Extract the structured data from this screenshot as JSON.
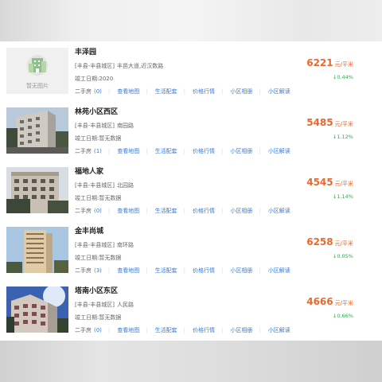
{
  "labels": {
    "no_image": "暂无图片",
    "year_prefix": "竣工日期:",
    "second_hand": "二手房",
    "map": "查看地图",
    "life": "生活配套",
    "price_trend": "价格行情",
    "album": "小区相册",
    "review": "小区解读",
    "price_unit": "元/平米"
  },
  "listings": [
    {
      "name": "丰泽园",
      "district": "[丰县-丰县城区]",
      "address": "丰邑大道,近汉数路",
      "year": "2020",
      "count": "(0)",
      "price": "6221",
      "change": "↓0.44%",
      "image": "no-image"
    },
    {
      "name": "林苑小区西区",
      "district": "[丰县-丰县城区]",
      "address": "南园路",
      "year": "暂无数据",
      "count": "(1)",
      "price": "5485",
      "change": "↓1.12%",
      "image": "building-photo"
    },
    {
      "name": "福地人家",
      "district": "[丰县-丰县城区]",
      "address": "北园路",
      "year": "暂无数据",
      "count": "(0)",
      "price": "4545",
      "change": "↓1.14%",
      "image": "building-photo"
    },
    {
      "name": "金丰尚城",
      "district": "[丰县-丰县城区]",
      "address": "南环路",
      "year": "暂无数据",
      "count": "(3)",
      "price": "6258",
      "change": "↓0.05%",
      "image": "building-photo"
    },
    {
      "name": "塔南小区东区",
      "district": "[丰县-丰县城区]",
      "address": "人民路",
      "year": "暂无数据",
      "count": "(0)",
      "price": "4666",
      "change": "↓0.66%",
      "image": "building-photo"
    }
  ]
}
